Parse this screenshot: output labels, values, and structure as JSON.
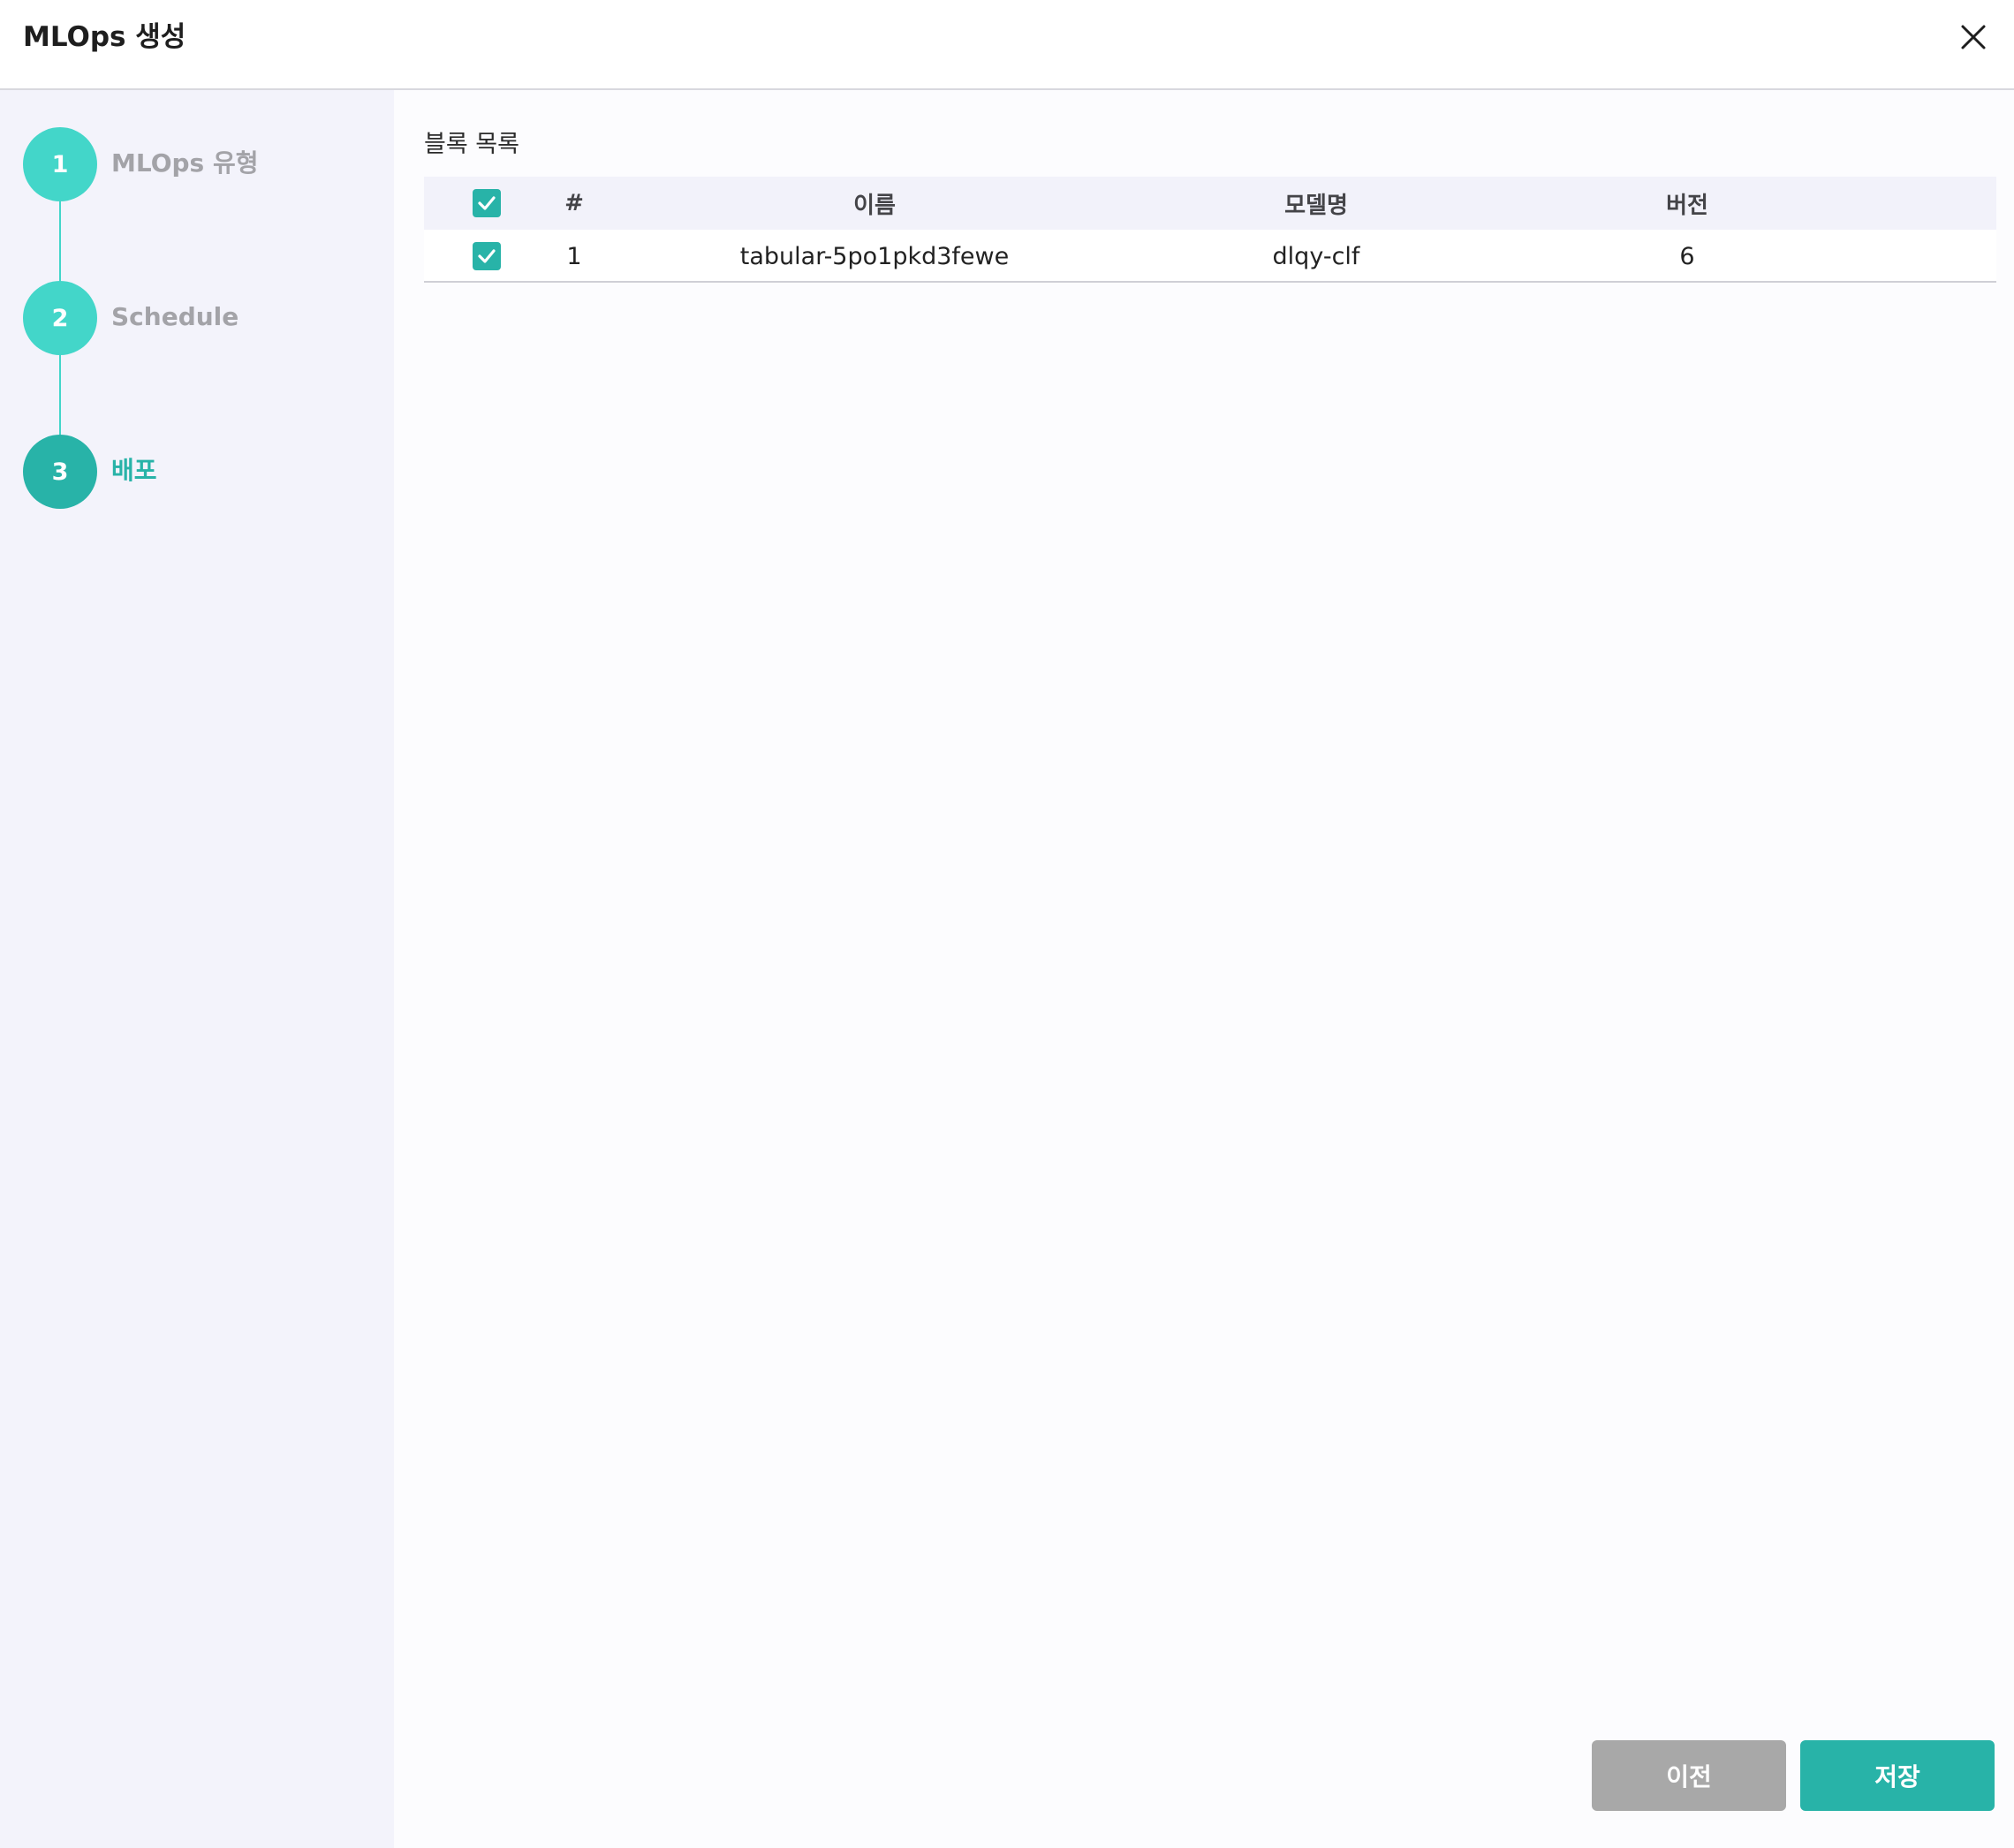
{
  "modal": {
    "title": "MLOps 생성"
  },
  "steps": [
    {
      "number": "1",
      "label": "MLOps 유형",
      "state": "completed"
    },
    {
      "number": "2",
      "label": "Schedule",
      "state": "completed"
    },
    {
      "number": "3",
      "label": "배포",
      "state": "active"
    }
  ],
  "block_list": {
    "title": "블록 목록",
    "columns": {
      "number": "#",
      "name": "이름",
      "model_name": "모델명",
      "version": "버전"
    },
    "header_checked": true,
    "rows": [
      {
        "checked": true,
        "number": "1",
        "name": "tabular-5po1pkd3fewe",
        "model_name": "dlqy-clf",
        "version": "6"
      }
    ]
  },
  "footer": {
    "prev_label": "이전",
    "save_label": "저장"
  },
  "colors": {
    "accent": "#28b3a8",
    "step_circle": "#43d6c9",
    "inactive_button": "#a8a8a8",
    "sidebar_bg": "#f3f3fb"
  },
  "icons": {
    "close": "close-icon",
    "checkbox": "checkmark-icon"
  }
}
